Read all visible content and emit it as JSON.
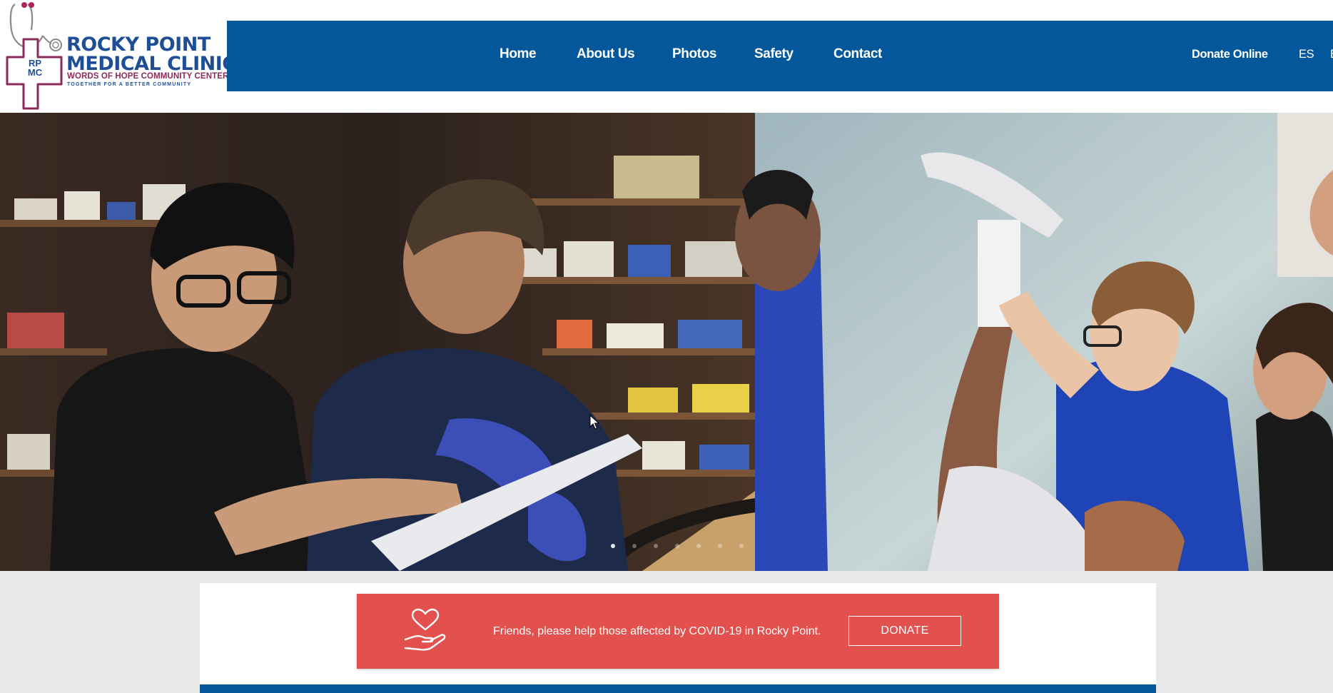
{
  "brand": {
    "monogram_top": "RP",
    "monogram_bottom": "MC",
    "title_line1": "ROCKY POINT",
    "title_line2": "MEDICAL CLINIC",
    "subtitle": "WORDS OF HOPE COMMUNITY CENTER",
    "tagline": "TOGETHER FOR A BETTER COMMUNITY",
    "colors": {
      "navy": "#1e4f96",
      "maroon": "#8c2a5a"
    }
  },
  "nav": {
    "items": [
      {
        "label": "Home"
      },
      {
        "label": "About Us"
      },
      {
        "label": "Photos"
      },
      {
        "label": "Safety"
      },
      {
        "label": "Contact"
      }
    ],
    "donate_online": "Donate Online",
    "language": "ES",
    "language_next": "E",
    "bg_color": "#04579a"
  },
  "hero": {
    "slides_total": 7,
    "active_slide": 1,
    "left_photo": "pharmacy-staff-reviewing-document",
    "right_photo": "physical-therapy-leg-stretch"
  },
  "donate_banner": {
    "icon": "heart-in-hand-icon",
    "message": "Friends, please help those affected by COVID-19 in Rocky Point.",
    "button_label": "DONATE",
    "bg_color": "#e2514d"
  }
}
